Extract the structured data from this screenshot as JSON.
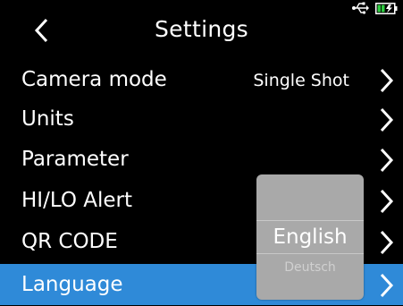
{
  "header": {
    "title": "Settings",
    "back_icon": "chevron-left-icon",
    "usb_icon": "usb-icon",
    "battery_icon": "battery-charging-icon",
    "battery_color": "#2ecc40"
  },
  "menu": {
    "items": [
      {
        "label": "Camera mode",
        "value": "Single Shot"
      },
      {
        "label": "Units",
        "value": ""
      },
      {
        "label": "Parameter",
        "value": ""
      },
      {
        "label": "HI/LO Alert",
        "value": ""
      },
      {
        "label": "QR CODE",
        "value": ""
      },
      {
        "label": "Language",
        "value": ""
      }
    ],
    "selected_index": 5,
    "selected_color": "#2f8ad8"
  },
  "language_picker": {
    "options": [
      "English",
      "Deutsch"
    ],
    "selected": "English"
  }
}
